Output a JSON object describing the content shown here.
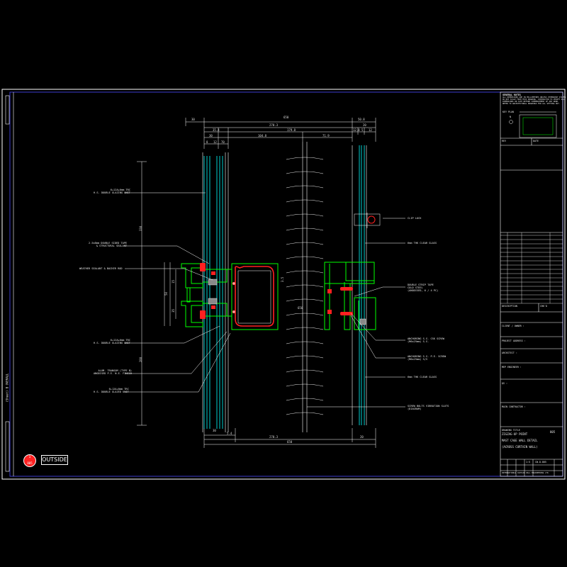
{
  "drawing": {
    "outside_label": "OUTSIDE",
    "marker_number": "1",
    "marker_sheet": "805",
    "side_label": "(Sheet) B OVERALL",
    "colors": {
      "background": "#000000",
      "border": "#ffffff",
      "profile": "#00ff00",
      "gasket": "#ff2020",
      "glass": "#00ffff",
      "frame_line": "#0000ff"
    }
  },
  "top_dims": {
    "row1": {
      "d30": "30",
      "d650": "650",
      "d508": "50.8"
    },
    "row2": {
      "d2703": "270.3",
      "d20": "20"
    },
    "row3": {
      "d35a": "35.4",
      "d1798": "179.8",
      "d38": "12.8",
      "d5": "5",
      "d14": "12"
    },
    "row4": {
      "d30a": "30",
      "d104": "104.8",
      "d719": "71.9"
    },
    "row5": {
      "d12a": "8",
      "d12b": "12",
      "d70": "70"
    }
  },
  "bottom_dims": {
    "d30": "30",
    "d54": "5.4",
    "d2703": "270.3",
    "d20": "20",
    "d650": "650"
  },
  "vertical_dims": {
    "v1": "330",
    "v2": "280",
    "v3": "15",
    "v4": "50",
    "v5": "35",
    "v6": "3.5"
  },
  "center_dims": {
    "mid": "650"
  },
  "left_notes": [
    "6+12A+6mm TRC\nH.S. DOUBLE GLAZING UNIT",
    "2.5x8mm DOUBLE SIDED TAPE\n& STRUCTURAL SEALANT",
    "WEATHER SEALANT & BACKER ROD",
    "6+12A+6mm TRC\nH.S. DOUBLE GLAZING UNIT",
    "ALUM. TRANSOM (TYPE B)\nANODISED P.E. N.E. FINISH",
    "6+12A+6mm TRC\nH.S. DOUBLE GLAZED UNIT"
  ],
  "right_notes": [
    "CLIP LOCK",
    "6mm THK CLEAR GLASS",
    "DOUBLE STRIP TAPE\nCOLD STEEL\n(ANODISED, 6 / 4 PC)",
    "ANCHORING S.S. CSK SCREW\n(M6x25mm) S.S.",
    "ANCHORING S.S. P.E. SCREW\n(M6x25mm) S/S",
    "6mm THK CLEAR GLASS",
    "SCREW BOLTS VIBRATION SLOTS\n(DIAGRAM)"
  ],
  "title_block": {
    "notes_heading": "GENERAL NOTES",
    "notes_lines": [
      "ALL DIMENSIONS ARE IN MILLIMETRES UNLESS OTHERWISE STATED.",
      "DO NOT SCALE FROM THIS DRAWING. CONTRACTOR TO VERIFY ALL",
      "DIMENSIONS ON SITE BEFORE COMMENCEMENT OF ANY WORK.",
      "REFER TO ARCHITECTURAL DRAWINGS FOR ALL SETTING OUT."
    ],
    "key_plan": "KEY PLAN",
    "north": "N",
    "cells": [
      "REV",
      "DATE",
      "DESCRIPTION",
      "CHK'D"
    ],
    "client": "CLIENT / OWNER :",
    "project": "PROJECT ADDRESS :",
    "architect": "ARCHITECT :",
    "consultant": "MEP ENGINEER :",
    "qs": "QS :",
    "contractor": "MAIN CONTRACTOR :",
    "title_label": "DRAWING TITLE",
    "title_lines": [
      "ZIGZAG-UP POINT",
      "MAST CAGE WALL DETAIL",
      "(ACROSS CURTAIN WALL)"
    ],
    "sheet_no": "805",
    "scale": "1:5",
    "dwg_no": "CW-D-805",
    "footer": "INTERNATIONAL CURTAIN WALL ENGINEERING LTD."
  }
}
